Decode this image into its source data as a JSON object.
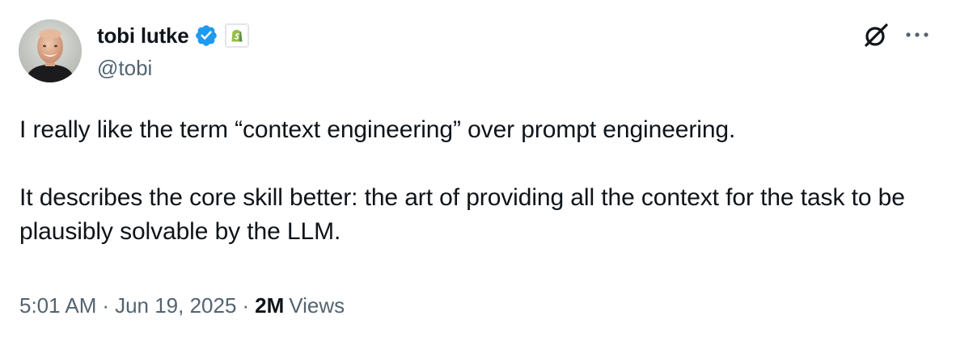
{
  "author": {
    "display_name": "tobi lutke",
    "handle": "@tobi",
    "verified": true,
    "affiliate": "shopify"
  },
  "tweet": {
    "paragraphs": [
      "I really like the term “context engineering” over prompt engineering.",
      "It describes the core skill better: the art of providing all the context for the task to be plausibly solvable by the LLM."
    ],
    "time": "5:01 AM",
    "date": "Jun 19, 2025",
    "separator": "·",
    "views_count": "2M",
    "views_label": "Views"
  },
  "icons": {
    "verified": "verified-badge-icon",
    "affiliate": "shopify-logo-icon",
    "grok": "grok-icon",
    "more": "more-options-icon"
  },
  "colors": {
    "text_primary": "#0f1419",
    "text_secondary": "#536471",
    "verified_blue": "#1d9bf0",
    "shopify_green": "#95bf47"
  }
}
